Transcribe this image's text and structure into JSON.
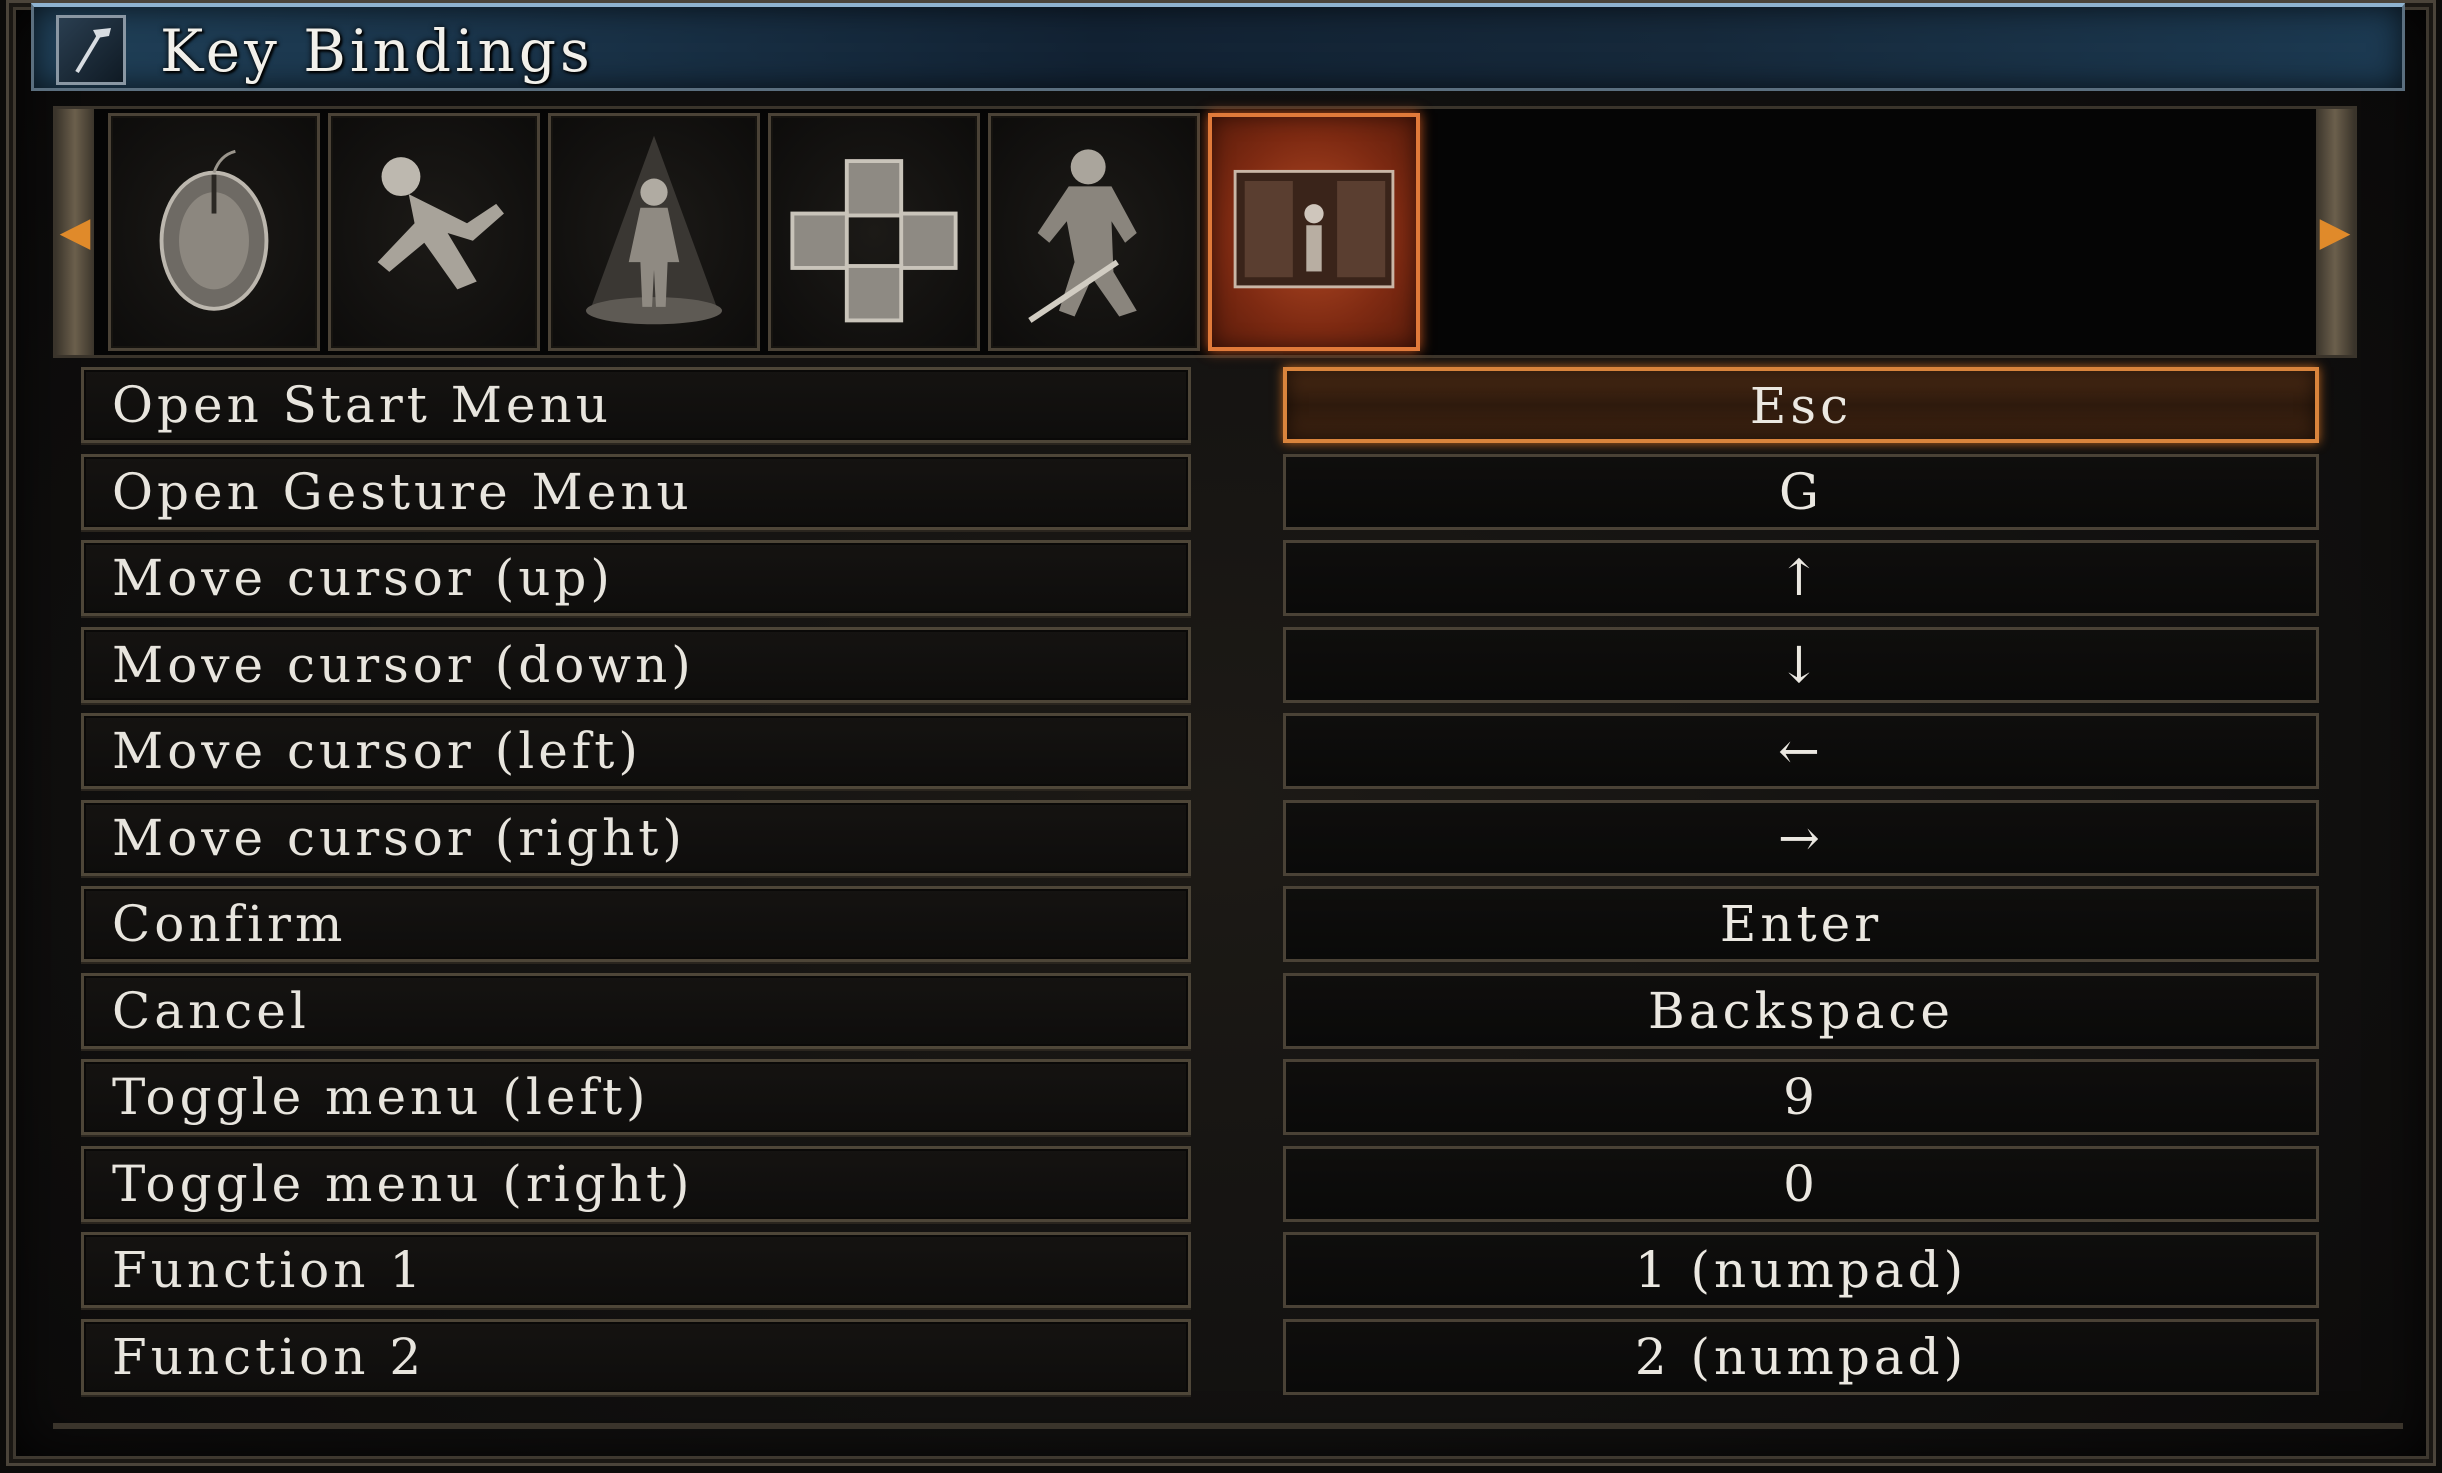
{
  "window": {
    "title": "Key Bindings",
    "title_icon": "hammer-icon"
  },
  "tabs": [
    {
      "name": "mouse-icon",
      "active": false
    },
    {
      "name": "running-figure-icon",
      "active": false
    },
    {
      "name": "character-spotlight-icon",
      "active": false
    },
    {
      "name": "equipment-slots-icon",
      "active": false
    },
    {
      "name": "knight-warrior-icon",
      "active": false
    },
    {
      "name": "menu-screen-icon",
      "active": true
    }
  ],
  "colors": {
    "accent": "#e07a3a",
    "active_tab": "#9a3a18",
    "title_bar": "#1a344a"
  },
  "bindings": [
    {
      "action": "Open Start Menu",
      "key": "Esc",
      "selected": true
    },
    {
      "action": "Open Gesture Menu",
      "key": "G",
      "selected": false
    },
    {
      "action": "Move cursor (up)",
      "key": "↑",
      "selected": false
    },
    {
      "action": "Move cursor (down)",
      "key": "↓",
      "selected": false
    },
    {
      "action": "Move cursor (left)",
      "key": "←",
      "selected": false
    },
    {
      "action": "Move cursor (right)",
      "key": "→",
      "selected": false
    },
    {
      "action": "Confirm",
      "key": "Enter",
      "selected": false
    },
    {
      "action": "Cancel",
      "key": "Backspace",
      "selected": false
    },
    {
      "action": "Toggle menu (left)",
      "key": "9",
      "selected": false
    },
    {
      "action": "Toggle menu (right)",
      "key": "0",
      "selected": false
    },
    {
      "action": "Function 1",
      "key": "1 (numpad)",
      "selected": false
    },
    {
      "action": "Function 2",
      "key": "2 (numpad)",
      "selected": false
    }
  ]
}
